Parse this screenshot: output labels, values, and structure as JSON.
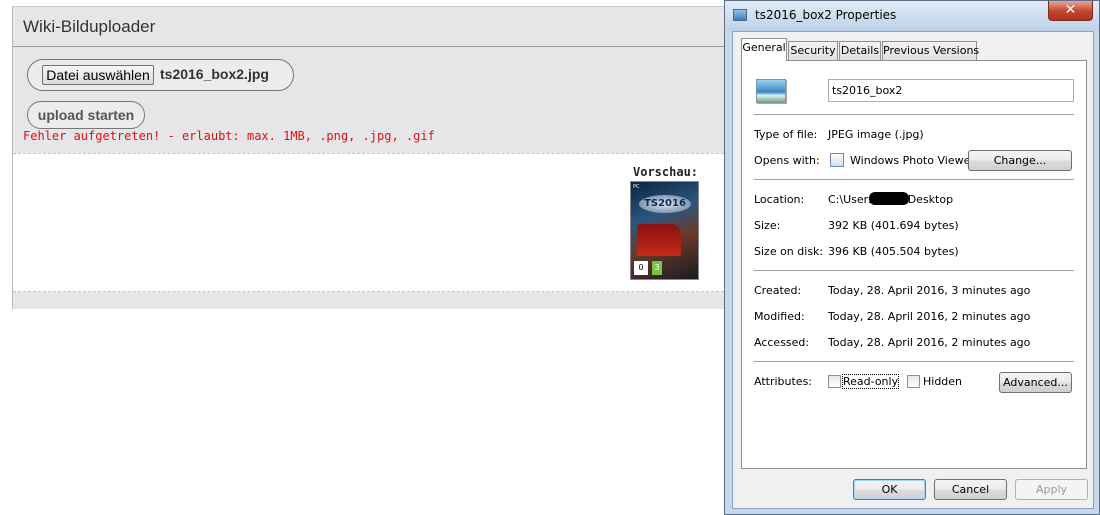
{
  "uploader": {
    "title": "Wiki-Bilduploader",
    "choose_file_label": "Datei auswählen",
    "file_name": "ts2016_box2.jpg",
    "upload_label": "upload starten",
    "error": "Fehler aufgetreten! - erlaubt: max. 1MB, .png, .jpg, .gif",
    "preview_label": "Vorschau:",
    "preview_image": {
      "platform": "PC",
      "logo_text": "TS2016",
      "age_rating": "0",
      "age_rating_2": "3"
    }
  },
  "dialog": {
    "title": "ts2016_box2 Properties",
    "close_symbol": "✕",
    "tabs": [
      {
        "label": "General",
        "active": true
      },
      {
        "label": "Security",
        "active": false
      },
      {
        "label": "Details",
        "active": false
      },
      {
        "label": "Previous Versions",
        "active": false
      }
    ],
    "general": {
      "file_name_value": "ts2016_box2",
      "type_label": "Type of file:",
      "type_value": "JPEG image (.jpg)",
      "opens_label": "Opens with:",
      "opens_value": "Windows Photo Viewer",
      "change_label": "Change...",
      "location_label": "Location:",
      "location_value_start": "C:\\Users\\",
      "location_value_end": "\\Desktop",
      "size_label": "Size:",
      "size_value": "392 KB (401.694 bytes)",
      "size_on_disk_label": "Size on disk:",
      "size_on_disk_value": "396 KB (405.504 bytes)",
      "created_label": "Created:",
      "created_value": "Today, 28. April 2016, 3 minutes ago",
      "modified_label": "Modified:",
      "modified_value": "Today, 28. April 2016, 2 minutes ago",
      "accessed_label": "Accessed:",
      "accessed_value": "Today, 28. April 2016, 2 minutes ago",
      "attributes_label": "Attributes:",
      "read_only_label": "Read-only",
      "read_only_checked": false,
      "hidden_label": "Hidden",
      "hidden_checked": false,
      "advanced_label": "Advanced..."
    },
    "buttons": {
      "ok": "OK",
      "cancel": "Cancel",
      "apply": "Apply"
    }
  }
}
